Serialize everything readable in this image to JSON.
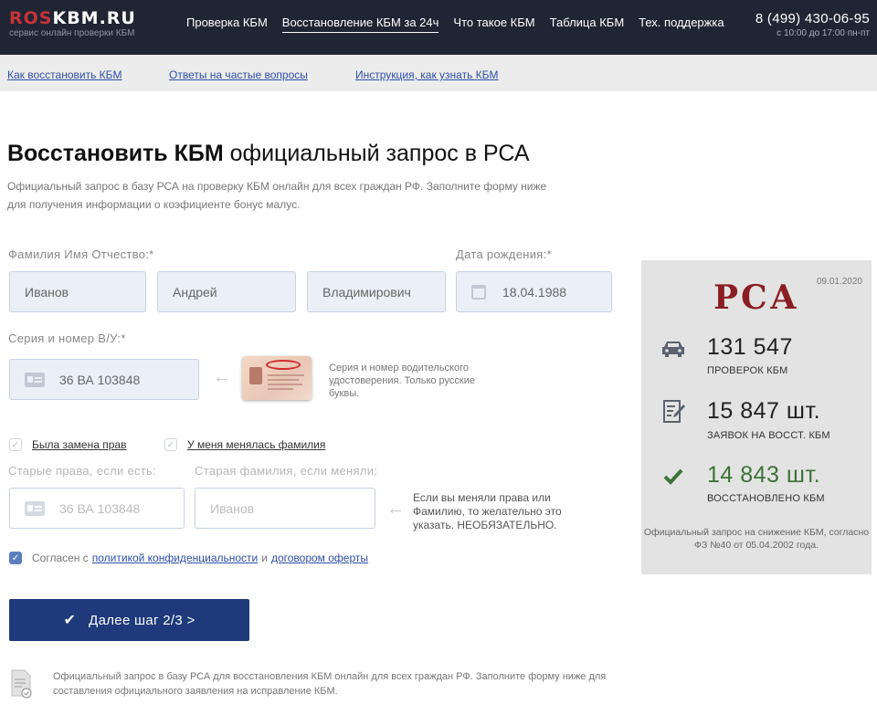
{
  "header": {
    "logo_ros": "ROS",
    "logo_main": "KBM.RU",
    "logo_sub": "сервис онлайн проверки КБМ",
    "nav": [
      "Проверка КБМ",
      "Восстановление КБМ за 24ч",
      "Что такое КБМ",
      "Таблица КБМ",
      "Тех. поддержка"
    ],
    "phone": "8 (499) 430-06-95",
    "hours": "с 10:00 до 17:00 пн-пт"
  },
  "subnav": [
    "Как восстановить КБМ",
    "Ответы на частые вопросы",
    "Инструкция, как узнать КБМ"
  ],
  "title": {
    "bold": "Восстановить КБМ",
    "rest": " официальный запрос в РСА"
  },
  "intro": "Официальный запрос в базу РСА на проверку КБМ онлайн для всех граждан РФ. Заполните форму ниже для получения информации о коэфициенте бонус малус.",
  "form": {
    "fio_label": "Фамилия Имя Отчество:*",
    "last_name": "Иванов",
    "first_name": "Андрей",
    "middle_name": "Владимирович",
    "dob_label": "Дата рождения:*",
    "dob": "18.04.1988",
    "license_label": "Серия и номер В/У:*",
    "license": "36 ВА 103848",
    "license_hint": "Серия и номер водительского удостоверения. Только русские буквы.",
    "check_license_changed": "Была замена прав",
    "check_name_changed": "У меня менялась фамилия",
    "old_license_label": "Старые права, если есть:",
    "old_license": "36 ВА 103848",
    "old_name_label": "Старая фамилия, если меняли:",
    "old_name": "Иванов",
    "old_hint": "Если вы меняли права или Фамилию, то желательно это указать. НЕОБЯЗАТЕЛЬНО.",
    "agree_prefix": "Согласен с",
    "agree_privacy": "политикой конфиденциальности",
    "agree_and": "и",
    "agree_offer": "договором оферты",
    "submit": "Далее шаг 2/3 >"
  },
  "footer_text": "Официальный запрос в базу РСА для восстановления КБМ онлайн для всех граждан РФ. Заполните форму ниже для составления официального заявления на исправление КБМ.",
  "panel": {
    "date": "09.01.2020",
    "logo": "РСА",
    "stats": [
      {
        "icon": "car-icon",
        "value": "131 547",
        "label": "ПРОВЕРОК КБМ"
      },
      {
        "icon": "document-edit-icon",
        "value": "15 847 шт.",
        "label": "ЗАЯВОК НА ВОССТ. КБМ"
      },
      {
        "icon": "checkmark-icon",
        "value": "14 843 шт.",
        "label": "ВОССТАНОВЛЕНО КБМ"
      }
    ],
    "footer": "Официальный запрос на снижение КБМ, согласно ФЗ №40 от 05.04.2002 года."
  },
  "colors": {
    "header_bg": "#1f2533",
    "accent_red": "#c8323a",
    "button": "#1e3a7b",
    "link": "#2d4fa8",
    "green": "#3d7338"
  }
}
